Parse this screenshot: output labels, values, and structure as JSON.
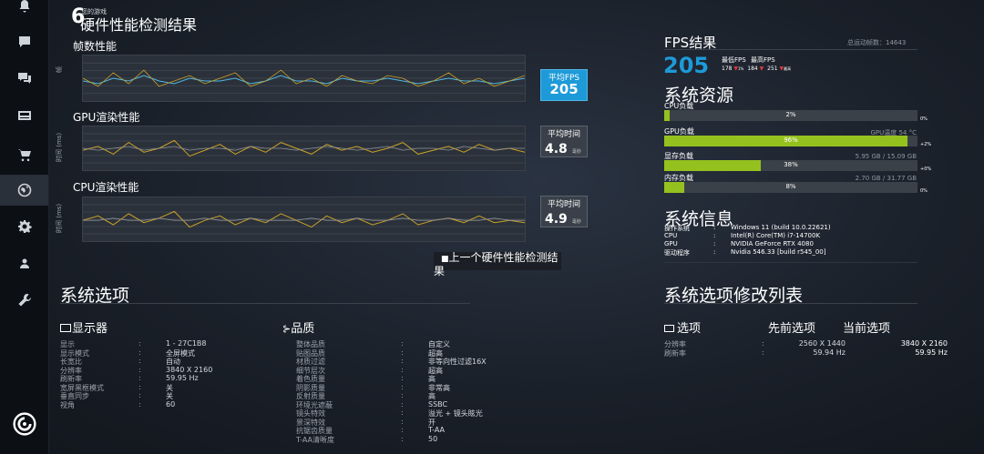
{
  "header": {
    "subtitle": "您的游戏",
    "title": "硬件性能检测结果"
  },
  "charts": {
    "fps": {
      "title": "帧数性能",
      "badge_label": "平均FPS",
      "badge_value": "205",
      "y_ticks": [
        "",
        "",
        "",
        "",
        "",
        ""
      ],
      "axis_label": "帧",
      "series": [
        {
          "color": "#4fb7e6",
          "values": [
            205,
            204,
            206,
            205,
            207,
            205,
            204,
            206,
            205,
            205,
            206,
            204,
            205,
            207,
            205,
            205,
            204,
            206,
            205,
            205,
            206,
            205,
            204,
            205,
            206,
            205,
            205,
            204,
            205,
            206
          ]
        },
        {
          "color": "#c9a227",
          "values": [
            206,
            203,
            208,
            204,
            209,
            203,
            205,
            207,
            204,
            206,
            208,
            203,
            205,
            209,
            204,
            206,
            203,
            207,
            205,
            204,
            207,
            206,
            203,
            205,
            208,
            204,
            206,
            203,
            205,
            207
          ]
        }
      ]
    },
    "gpu": {
      "title": "GPU渲染性能",
      "badge_label": "平均时间",
      "badge_value": "4.8",
      "badge_unit": "毫秒",
      "axis_label": "时间 (ms)",
      "series": [
        {
          "color": "#c9a227",
          "values": [
            4.8,
            5.0,
            4.6,
            5.2,
            4.7,
            4.9,
            5.3,
            4.5,
            4.8,
            5.1,
            4.6,
            5.0,
            4.7,
            5.2,
            4.9,
            4.6,
            5.1,
            4.8,
            5.0,
            4.7,
            4.9,
            5.2,
            4.6,
            4.8,
            5.0,
            4.7,
            5.1,
            4.8,
            4.9,
            4.7
          ]
        },
        {
          "color": "#8c8f94",
          "values": [
            4.9,
            4.8,
            4.9,
            5.0,
            4.8,
            4.9,
            5.0,
            4.8,
            4.9,
            4.9,
            4.8,
            5.0,
            4.9,
            4.9,
            4.8,
            4.9,
            5.0,
            4.9,
            4.8,
            4.9,
            5.0,
            4.8,
            4.9,
            4.9,
            4.8,
            5.0,
            4.9,
            4.8,
            4.9,
            4.9
          ]
        }
      ]
    },
    "cpu": {
      "title": "CPU渲染性能",
      "badge_label": "平均时间",
      "badge_value": "4.9",
      "badge_unit": "毫秒",
      "axis_label": "时间 (ms)",
      "series": [
        {
          "color": "#c9a227",
          "values": [
            4.9,
            5.1,
            4.7,
            5.2,
            4.8,
            5.0,
            5.3,
            4.6,
            4.9,
            5.1,
            4.7,
            5.0,
            4.8,
            5.2,
            4.9,
            4.6,
            5.1,
            4.8,
            5.0,
            4.7,
            4.9,
            5.2,
            4.7,
            4.9,
            5.0,
            4.8,
            5.1,
            4.8,
            4.9,
            4.8
          ]
        },
        {
          "color": "#8c8f94",
          "values": [
            4.9,
            4.9,
            5.0,
            4.9,
            4.9,
            5.0,
            4.9,
            4.9,
            5.0,
            4.9,
            4.9,
            5.0,
            4.9,
            4.9,
            4.9,
            5.0,
            4.9,
            4.9,
            5.0,
            4.9,
            4.9,
            5.0,
            4.9,
            4.9,
            5.0,
            4.9,
            4.9,
            5.0,
            4.9,
            4.9
          ]
        }
      ]
    }
  },
  "prev_button": {
    "icon": "■",
    "label": "上一个硬件性能检测结果"
  },
  "fps_result": {
    "title": "FPS结果",
    "total_label": "总运动帧数：14643",
    "avg": "205",
    "min_label": "最低FPS",
    "max_label": "最高FPS",
    "min_values": [
      {
        "v": "178",
        "tag": "1%"
      },
      {
        "v": "184",
        "tag": ""
      },
      {
        "v": "251",
        "tag": "最高"
      }
    ]
  },
  "system_resources": {
    "title": "系统资源",
    "items": [
      {
        "label": "CPU负载",
        "right_info": "",
        "bar_text": "2%",
        "fill": 0.02,
        "side": "0%"
      },
      {
        "label": "GPU负载",
        "right_info": "GPU温度 54 °C",
        "bar_text": "96%",
        "fill": 0.96,
        "side": "+2%"
      },
      {
        "label": "显存负载",
        "right_info": "5.95 GB / 15.09 GB",
        "bar_text": "38%",
        "fill": 0.38,
        "side": "+0%"
      },
      {
        "label": "内存负载",
        "right_info": "2.70 GB / 31.77 GB",
        "bar_text": "8%",
        "fill": 0.08,
        "side": "0%"
      }
    ]
  },
  "system_info": {
    "title": "系统信息",
    "rows": [
      {
        "k": "操作系统",
        "v": "Windows 11 (build 10.0.22621)"
      },
      {
        "k": "CPU",
        "v": "Intel(R) Core(TM) i7-14700K"
      },
      {
        "k": "GPU",
        "v": "NVIDIA GeForce RTX 4080"
      },
      {
        "k": "驱动程序",
        "v": "Nvidia 546.33 [build r545_00]"
      }
    ]
  },
  "system_options": {
    "title": "系统选项",
    "display": {
      "title": "显示器",
      "rows": [
        {
          "k": "显示",
          "v": "1 - 27C1B8"
        },
        {
          "k": "显示模式",
          "v": "全屏模式"
        },
        {
          "k": "长宽比",
          "v": "自动"
        },
        {
          "k": "分辨率",
          "v": "3840 X 2160"
        },
        {
          "k": "刷新率",
          "v": "59.95 Hz"
        },
        {
          "k": "宽屏黑框模式",
          "v": "关"
        },
        {
          "k": "垂直同步",
          "v": "关"
        },
        {
          "k": "视角",
          "v": "60"
        }
      ]
    },
    "quality": {
      "title": "品质",
      "rows": [
        {
          "k": "整体品质",
          "v": "自定义"
        },
        {
          "k": "贴图品质",
          "v": "超高"
        },
        {
          "k": "材质过滤",
          "v": "非等向性过滤16X"
        },
        {
          "k": "细节层次",
          "v": "超高"
        },
        {
          "k": "着色质量",
          "v": "高"
        },
        {
          "k": "阴影质量",
          "v": "非常高"
        },
        {
          "k": "反射质量",
          "v": "高"
        },
        {
          "k": "环境光遮蔽",
          "v": "SSBC"
        },
        {
          "k": "镜头特效",
          "v": "溢光 + 镜头眩光"
        },
        {
          "k": "景深特效",
          "v": "开"
        },
        {
          "k": "抗锯齿质量",
          "v": "T-AA"
        },
        {
          "k": "T-AA清晰度",
          "v": "50"
        }
      ]
    }
  },
  "modified_options": {
    "title": "系统选项修改列表",
    "col_option": "选项",
    "col_prev": "先前选项",
    "col_curr": "当前选项",
    "rows": [
      {
        "k": "分辨率",
        "prev": "2560 X 1440",
        "curr": "3840 X 2160"
      },
      {
        "k": "刷新率",
        "prev": "59.94 Hz",
        "curr": "59.95 Hz"
      }
    ]
  }
}
